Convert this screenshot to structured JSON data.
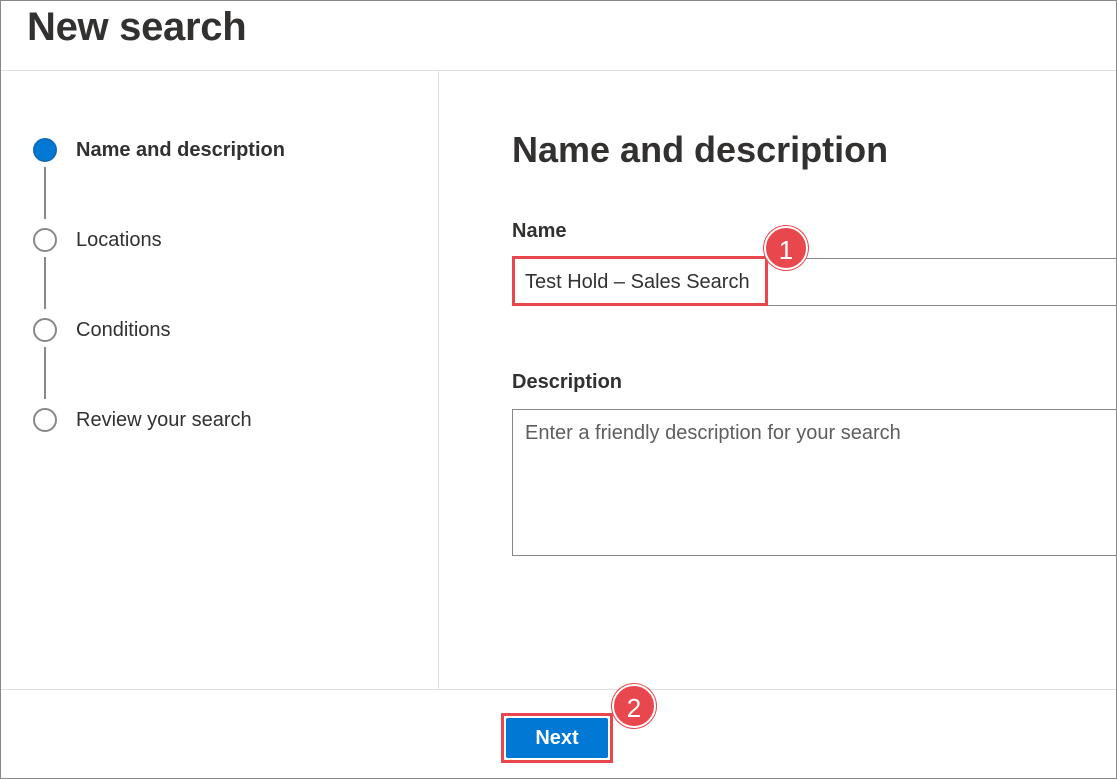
{
  "header": {
    "title": "New search"
  },
  "steps": [
    {
      "label": "Name and description",
      "state": "current"
    },
    {
      "label": "Locations",
      "state": "pending"
    },
    {
      "label": "Conditions",
      "state": "pending"
    },
    {
      "label": "Review your search",
      "state": "pending"
    }
  ],
  "form": {
    "section_title": "Name and description",
    "name_label": "Name",
    "name_value": "Test Hold – Sales Search",
    "description_label": "Description",
    "description_placeholder": "Enter a friendly description for your search"
  },
  "footer": {
    "next_label": "Next"
  },
  "callouts": {
    "first": "1",
    "second": "2"
  },
  "colors": {
    "accent": "#0078d4",
    "annotation": "#e8484d"
  }
}
